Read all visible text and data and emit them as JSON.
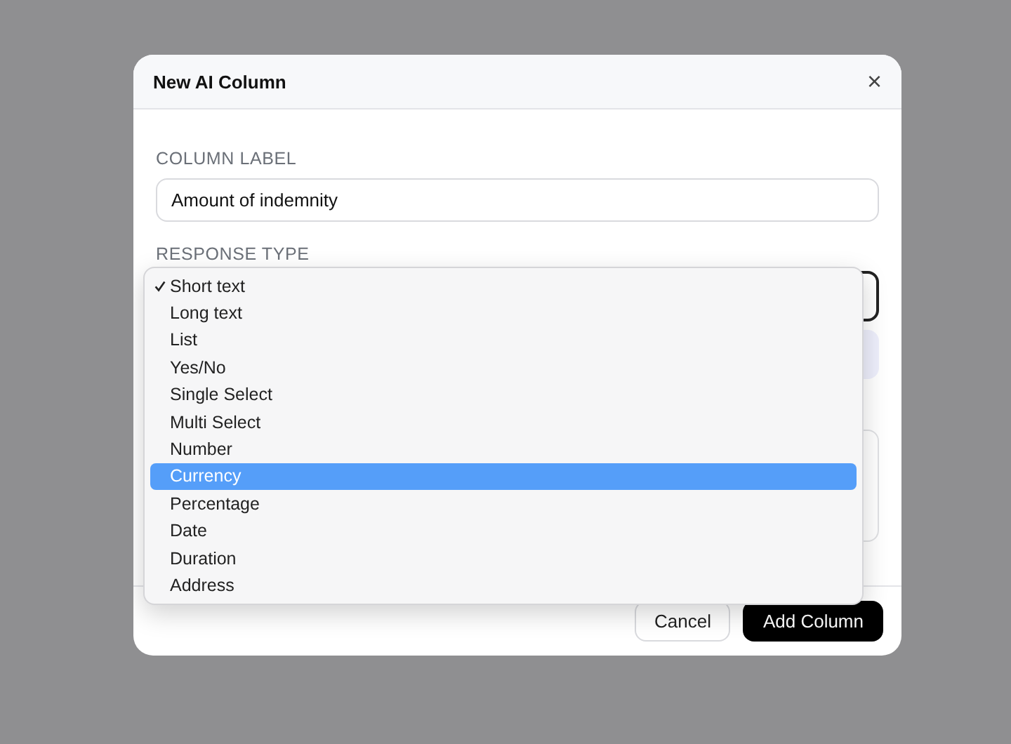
{
  "dialog": {
    "title": "New AI Column",
    "close": "×",
    "column_label": {
      "label": "COLUMN LABEL",
      "value": "Amount of indemnity"
    },
    "response_type": {
      "label": "RESPONSE TYPE"
    },
    "buttons": [
      {
        "label": "Cancel",
        "kind": "secondary"
      },
      {
        "label": "Add Column",
        "kind": "primary"
      }
    ]
  },
  "dropdown": {
    "items": [
      {
        "label": "Short text",
        "checked": true,
        "selected": false
      },
      {
        "label": "Long text",
        "checked": false,
        "selected": false
      },
      {
        "label": "List",
        "checked": false,
        "selected": false
      },
      {
        "label": "Yes/No",
        "checked": false,
        "selected": false
      },
      {
        "label": "Single Select",
        "checked": false,
        "selected": false
      },
      {
        "label": "Multi Select",
        "checked": false,
        "selected": false
      },
      {
        "label": "Number",
        "checked": false,
        "selected": false
      },
      {
        "label": "Currency",
        "checked": false,
        "selected": true
      },
      {
        "label": "Percentage",
        "checked": false,
        "selected": false
      },
      {
        "label": "Date",
        "checked": false,
        "selected": false
      },
      {
        "label": "Duration",
        "checked": false,
        "selected": false
      },
      {
        "label": "Address",
        "checked": false,
        "selected": false
      }
    ]
  }
}
